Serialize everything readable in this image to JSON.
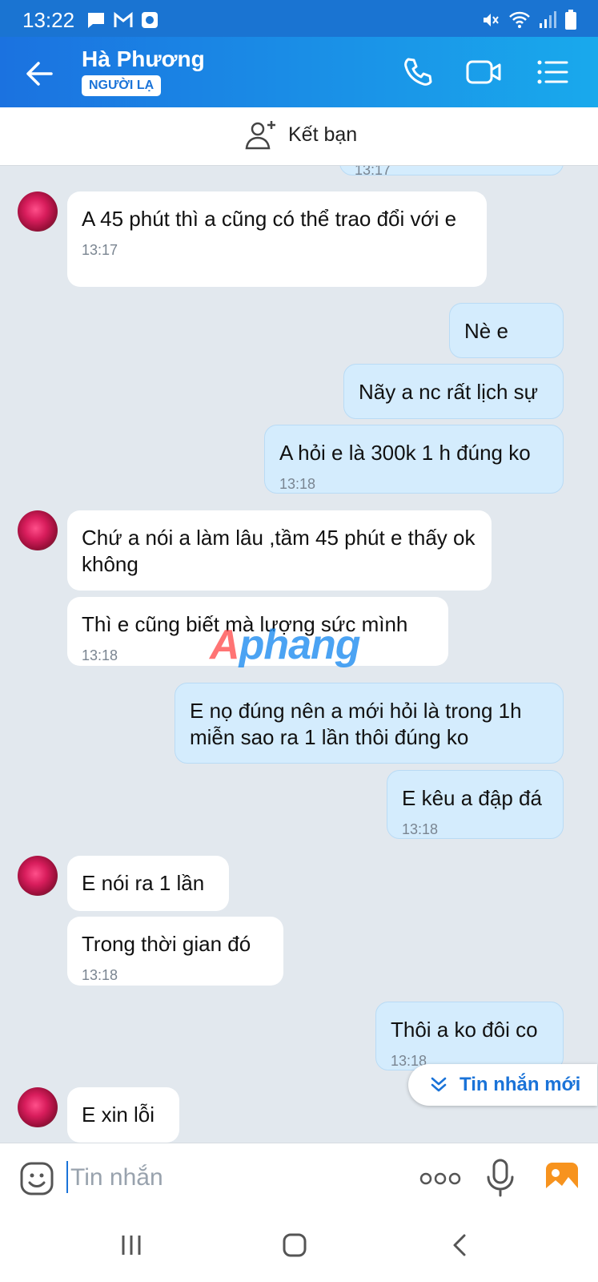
{
  "status_bar": {
    "time": "13:22"
  },
  "header": {
    "contact_name": "Hà Phương",
    "badge": "NGƯỜI LẠ"
  },
  "add_friend": {
    "label": "Kết bạn"
  },
  "chat": {
    "partial_top_time": "13:17",
    "messages": [
      {
        "side": "in",
        "text": "A 45 phút thì a cũng có thể trao đổi với e",
        "time": "13:17"
      },
      {
        "side": "out",
        "text": "Nè e",
        "time": ""
      },
      {
        "side": "out",
        "text": "Nãy a nc rất lịch sự",
        "time": ""
      },
      {
        "side": "out",
        "text": "A hỏi e là 300k 1 h đúng ko",
        "time": "13:18"
      },
      {
        "side": "in",
        "text": "Chứ a nói a làm lâu ,tầm 45 phút e thấy ok không",
        "time": ""
      },
      {
        "side": "in",
        "text": "Thì e cũng biết mà lượng sức mình",
        "time": "13:18"
      },
      {
        "side": "out",
        "text": "E nọ đúng nên a mới hỏi là trong 1h miễn sao ra 1 lần thôi đúng ko",
        "time": ""
      },
      {
        "side": "out",
        "text": "E kêu a đập đá",
        "time": "13:18"
      },
      {
        "side": "in",
        "text": "E nói ra 1 lần",
        "time": ""
      },
      {
        "side": "in",
        "text": "Trong thời gian đó",
        "time": "13:18"
      },
      {
        "side": "out",
        "text": "Thôi a ko đôi co",
        "time": "13:18"
      },
      {
        "side": "in",
        "text": "E xin lỗi",
        "time": ""
      }
    ]
  },
  "new_messages_button": {
    "label": "Tin nhắn mới"
  },
  "input": {
    "placeholder": "Tin nhắn"
  },
  "watermark": {
    "part1": "A",
    "part2": "phang"
  },
  "colors": {
    "header_start": "#1b72e0",
    "header_end": "#19a9ec",
    "outgoing_bubble": "#d4ecfd",
    "incoming_bubble": "#ffffff",
    "chat_bg": "#e2e8ee",
    "accent": "#1a73d8"
  }
}
